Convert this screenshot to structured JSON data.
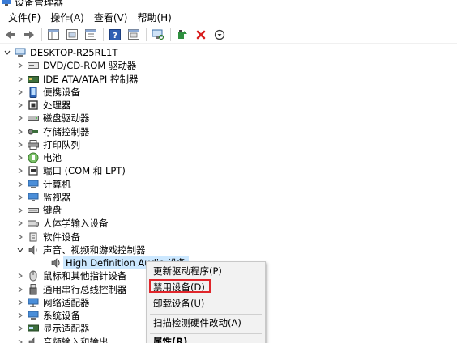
{
  "window": {
    "title": "设备管理器"
  },
  "menu": [
    {
      "label": "文件(F)"
    },
    {
      "label": "操作(A)"
    },
    {
      "label": "查看(V)"
    },
    {
      "label": "帮助(H)"
    }
  ],
  "tree": {
    "root": "DESKTOP-R25RL1T",
    "items": [
      {
        "label": "DVD/CD-ROM 驱动器",
        "icon": "disc-drive-icon"
      },
      {
        "label": "IDE ATA/ATAPI 控制器",
        "icon": "ide-controller-icon"
      },
      {
        "label": "便携设备",
        "icon": "portable-device-icon"
      },
      {
        "label": "处理器",
        "icon": "processor-icon"
      },
      {
        "label": "磁盘驱动器",
        "icon": "disk-drive-icon"
      },
      {
        "label": "存储控制器",
        "icon": "storage-controller-icon"
      },
      {
        "label": "打印队列",
        "icon": "printer-icon"
      },
      {
        "label": "电池",
        "icon": "battery-icon"
      },
      {
        "label": "端口 (COM 和 LPT)",
        "icon": "port-icon"
      },
      {
        "label": "计算机",
        "icon": "computer-icon"
      },
      {
        "label": "监视器",
        "icon": "monitor-icon"
      },
      {
        "label": "键盘",
        "icon": "keyboard-icon"
      },
      {
        "label": "人体学输入设备",
        "icon": "hid-icon"
      },
      {
        "label": "软件设备",
        "icon": "software-device-icon"
      },
      {
        "label": "声音、视频和游戏控制器",
        "icon": "audio-icon"
      }
    ],
    "expanded_child": {
      "label": "High Definition Audio 设备",
      "icon": "speaker-icon"
    },
    "items_after": [
      {
        "label": "鼠标和其他指针设备",
        "icon": "mouse-icon"
      },
      {
        "label": "通用串行总线控制器",
        "icon": "usb-icon"
      },
      {
        "label": "网络适配器",
        "icon": "network-adapter-icon"
      },
      {
        "label": "系统设备",
        "icon": "system-device-icon"
      },
      {
        "label": "显示适配器",
        "icon": "display-adapter-icon"
      },
      {
        "label": "音频输入和输出",
        "icon": "audio-io-icon"
      }
    ]
  },
  "context_menu": {
    "items": [
      {
        "label": "更新驱动程序(P)"
      },
      {
        "label": "禁用设备(D)"
      },
      {
        "label": "卸载设备(U)"
      },
      {
        "label": "扫描检测硬件改动(A)"
      },
      {
        "label": "属性(R)"
      }
    ],
    "highlight_color": "#e0262b"
  }
}
